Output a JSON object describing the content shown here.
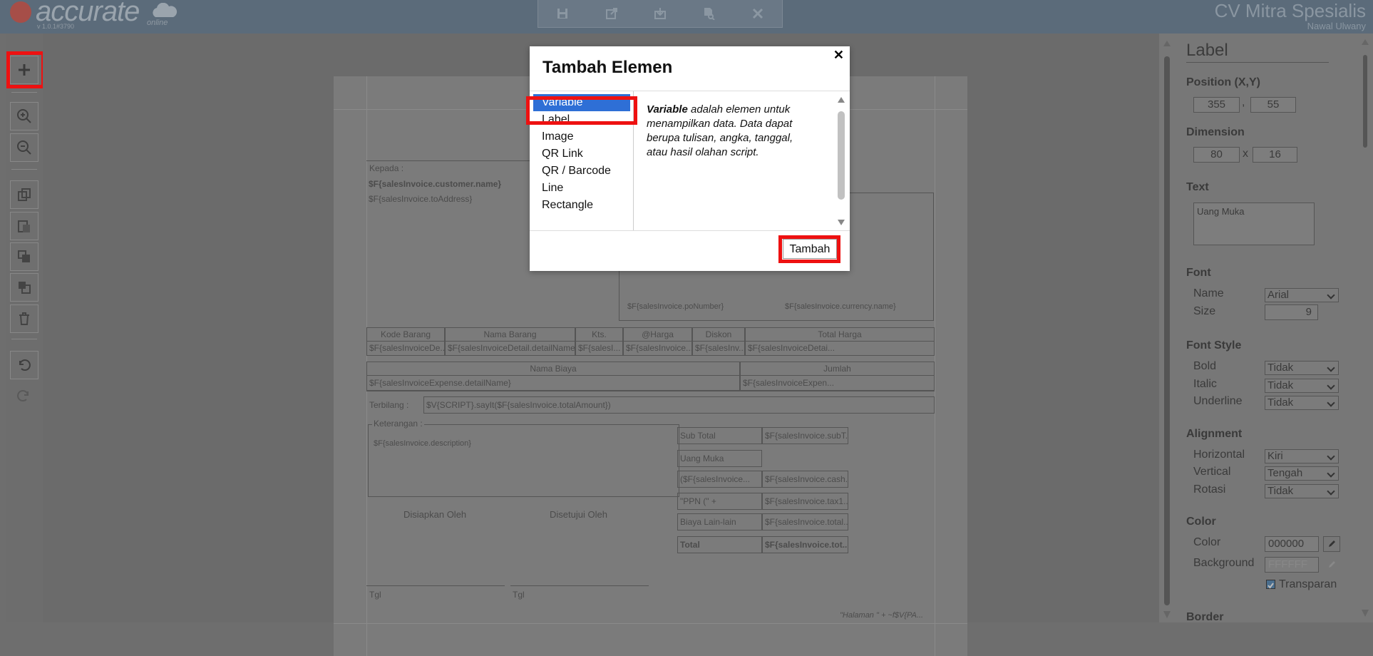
{
  "app": {
    "logo_text": "accurate",
    "logo_version": "v 1.0.1#3790",
    "logo_suffix": "online",
    "company_name": "CV Mitra Spesialis",
    "user_name": "Nawal Ulwany"
  },
  "document": {
    "kepada_label": "Kepada :",
    "customer_name_var": "$F{salesInvoice.customer.name}",
    "to_address_var": "$F{salesInvoice.toAddress}",
    "po_number_var": "$F{salesInvoice.poNumber}",
    "currency_var": "$F{salesInvoice.currency.name}",
    "item_table": {
      "headers": [
        "Kode Barang",
        "Nama Barang",
        "Kts.",
        "@Harga",
        "Diskon",
        "Total Harga"
      ],
      "cells": [
        "$F{salesInvoiceDe...",
        "$F{salesInvoiceDetail.detailName}",
        "$F{salesI...",
        "$F{salesInvoice...",
        "$F{salesInv...",
        "$F{salesInvoiceDetai..."
      ]
    },
    "expense_table": {
      "headers": [
        "Nama Biaya",
        "Jumlah"
      ],
      "cells": [
        "$F{salesInvoiceExpense.detailName}",
        "$F{salesInvoiceExpen..."
      ]
    },
    "terbilang_label": "Terbilang :",
    "terbilang_var": "$V{SCRIPT}.sayIt($F{salesInvoice.totalAmount})",
    "keterangan_label": "Keterangan :",
    "description_var": "$F{salesInvoice.description}",
    "disiapkan_label": "Disiapkan Oleh",
    "disetujui_label": "Disetujui Oleh",
    "tgl_label_1": "Tgl",
    "tgl_label_2": "Tgl",
    "footer_text": "\"Halaman \" + ~f$V{PA...",
    "totals": [
      {
        "label": "Sub Total",
        "value": "$F{salesInvoice.subT..."
      },
      {
        "label": "Uang Muka",
        "value": ""
      },
      {
        "label": "($F{salesInvoice...",
        "value": "$F{salesInvoice.cash..."
      },
      {
        "label": "\"PPN (\" +",
        "value": "$F{salesInvoice.tax1..."
      },
      {
        "label": "Biaya Lain-lain",
        "value": "$F{salesInvoice.total..."
      },
      {
        "label": "Total",
        "value": "$F{salesInvoice.tot..."
      }
    ]
  },
  "dialog": {
    "title": "Tambah Elemen",
    "items": [
      "Variable",
      "Label",
      "Image",
      "QR Link",
      "QR / Barcode",
      "Line",
      "Rectangle"
    ],
    "selected_index": 0,
    "description_bold": "Variable",
    "description_rest": " adalah elemen untuk menampilkan data. Data dapat berupa tulisan, angka, tanggal, atau hasil olahan script.",
    "add_button": "Tambah"
  },
  "properties": {
    "title": "Label",
    "position_label": "Position (X,Y)",
    "pos_x": "355",
    "pos_y": "55",
    "dimension_label": "Dimension",
    "dim_w": "80",
    "dim_h": "16",
    "dim_sep": "x",
    "pos_sep": ",",
    "text_label": "Text",
    "text_value": "Uang Muka",
    "font_label": "Font",
    "font_name_label": "Name",
    "font_name_value": "Arial",
    "font_size_label": "Size",
    "font_size_value": "9",
    "font_style_label": "Font Style",
    "bold_label": "Bold",
    "bold_value": "Tidak",
    "italic_label": "Italic",
    "italic_value": "Tidak",
    "underline_label": "Underline",
    "underline_value": "Tidak",
    "alignment_label": "Alignment",
    "horizontal_label": "Horizontal",
    "horizontal_value": "Kiri",
    "vertical_label": "Vertical",
    "vertical_value": "Tengah",
    "rotasi_label": "Rotasi",
    "rotasi_value": "Tidak",
    "color_section": "Color",
    "color_label": "Color",
    "color_value": "000000",
    "background_label": "Background",
    "background_value": "FFFFFF",
    "transparan_label": "Transparan",
    "border_label": "Border"
  },
  "colors": {
    "highlight": "#ee1111",
    "selected_item": "#2e6fd6"
  }
}
